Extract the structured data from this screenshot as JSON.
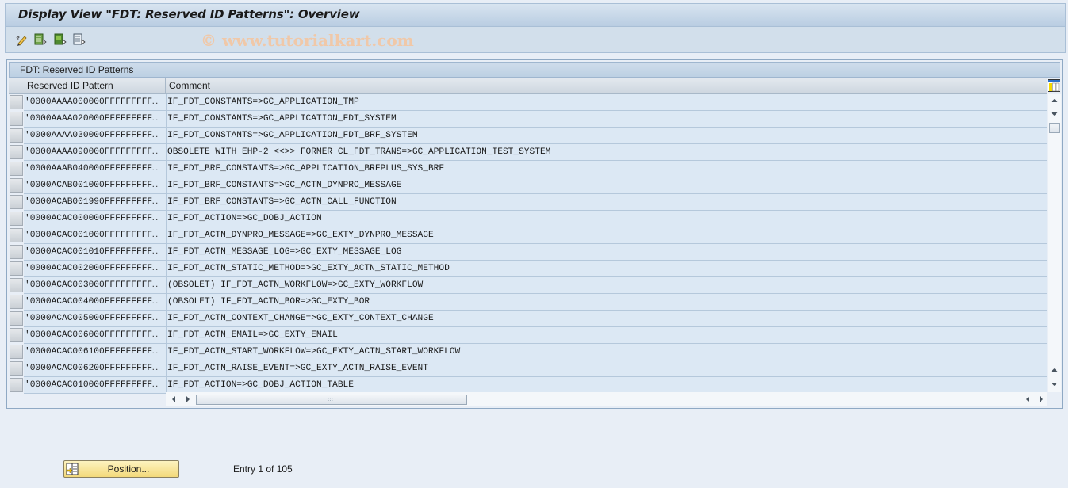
{
  "window": {
    "title": "Display View \"FDT: Reserved ID Patterns\": Overview",
    "watermark": "© www.tutorialkart.com"
  },
  "toolbar": {
    "icons": [
      "display-change-icon",
      "select-all-icon",
      "select-block-icon",
      "deselect-all-icon"
    ]
  },
  "table": {
    "title": "FDT: Reserved ID Patterns",
    "columns": [
      "Reserved ID Pattern",
      "Comment"
    ],
    "rows": [
      {
        "pattern": "'0000AAAA000000FFFFFFFFF…",
        "comment": "IF_FDT_CONSTANTS=>GC_APPLICATION_TMP"
      },
      {
        "pattern": "'0000AAAA020000FFFFFFFFF…",
        "comment": "IF_FDT_CONSTANTS=>GC_APPLICATION_FDT_SYSTEM"
      },
      {
        "pattern": "'0000AAAA030000FFFFFFFFF…",
        "comment": "IF_FDT_CONSTANTS=>GC_APPLICATION_FDT_BRF_SYSTEM"
      },
      {
        "pattern": "'0000AAAA090000FFFFFFFFF…",
        "comment": "OBSOLETE WITH EHP-2 <<>> FORMER CL_FDT_TRANS=>GC_APPLICATION_TEST_SYSTEM"
      },
      {
        "pattern": "'0000AAAB040000FFFFFFFFF…",
        "comment": "IF_FDT_BRF_CONSTANTS=>GC_APPLICATION_BRFPLUS_SYS_BRF"
      },
      {
        "pattern": "'0000ACAB001000FFFFFFFFF…",
        "comment": "IF_FDT_BRF_CONSTANTS=>GC_ACTN_DYNPRO_MESSAGE"
      },
      {
        "pattern": "'0000ACAB001990FFFFFFFFF…",
        "comment": "IF_FDT_BRF_CONSTANTS=>GC_ACTN_CALL_FUNCTION"
      },
      {
        "pattern": "'0000ACAC000000FFFFFFFFF…",
        "comment": "IF_FDT_ACTION=>GC_DOBJ_ACTION"
      },
      {
        "pattern": "'0000ACAC001000FFFFFFFFF…",
        "comment": "IF_FDT_ACTN_DYNPRO_MESSAGE=>GC_EXTY_DYNPRO_MESSAGE"
      },
      {
        "pattern": "'0000ACAC001010FFFFFFFFF…",
        "comment": "IF_FDT_ACTN_MESSAGE_LOG=>GC_EXTY_MESSAGE_LOG"
      },
      {
        "pattern": "'0000ACAC002000FFFFFFFFF…",
        "comment": "IF_FDT_ACTN_STATIC_METHOD=>GC_EXTY_ACTN_STATIC_METHOD"
      },
      {
        "pattern": "'0000ACAC003000FFFFFFFFF…",
        "comment": "(OBSOLET) IF_FDT_ACTN_WORKFLOW=>GC_EXTY_WORKFLOW"
      },
      {
        "pattern": "'0000ACAC004000FFFFFFFFF…",
        "comment": "(OBSOLET) IF_FDT_ACTN_BOR=>GC_EXTY_BOR"
      },
      {
        "pattern": "'0000ACAC005000FFFFFFFFF…",
        "comment": "IF_FDT_ACTN_CONTEXT_CHANGE=>GC_EXTY_CONTEXT_CHANGE"
      },
      {
        "pattern": "'0000ACAC006000FFFFFFFFF…",
        "comment": "IF_FDT_ACTN_EMAIL=>GC_EXTY_EMAIL"
      },
      {
        "pattern": "'0000ACAC006100FFFFFFFFF…",
        "comment": "IF_FDT_ACTN_START_WORKFLOW=>GC_EXTY_ACTN_START_WORKFLOW"
      },
      {
        "pattern": "'0000ACAC006200FFFFFFFFF…",
        "comment": "IF_FDT_ACTN_RAISE_EVENT=>GC_EXTY_ACTN_RAISE_EVENT"
      },
      {
        "pattern": "'0000ACAC010000FFFFFFFFF…",
        "comment": "IF_FDT_ACTION=>GC_DOBJ_ACTION_TABLE"
      }
    ]
  },
  "footer": {
    "position_button": "Position...",
    "entry_info": "Entry 1 of 105"
  }
}
